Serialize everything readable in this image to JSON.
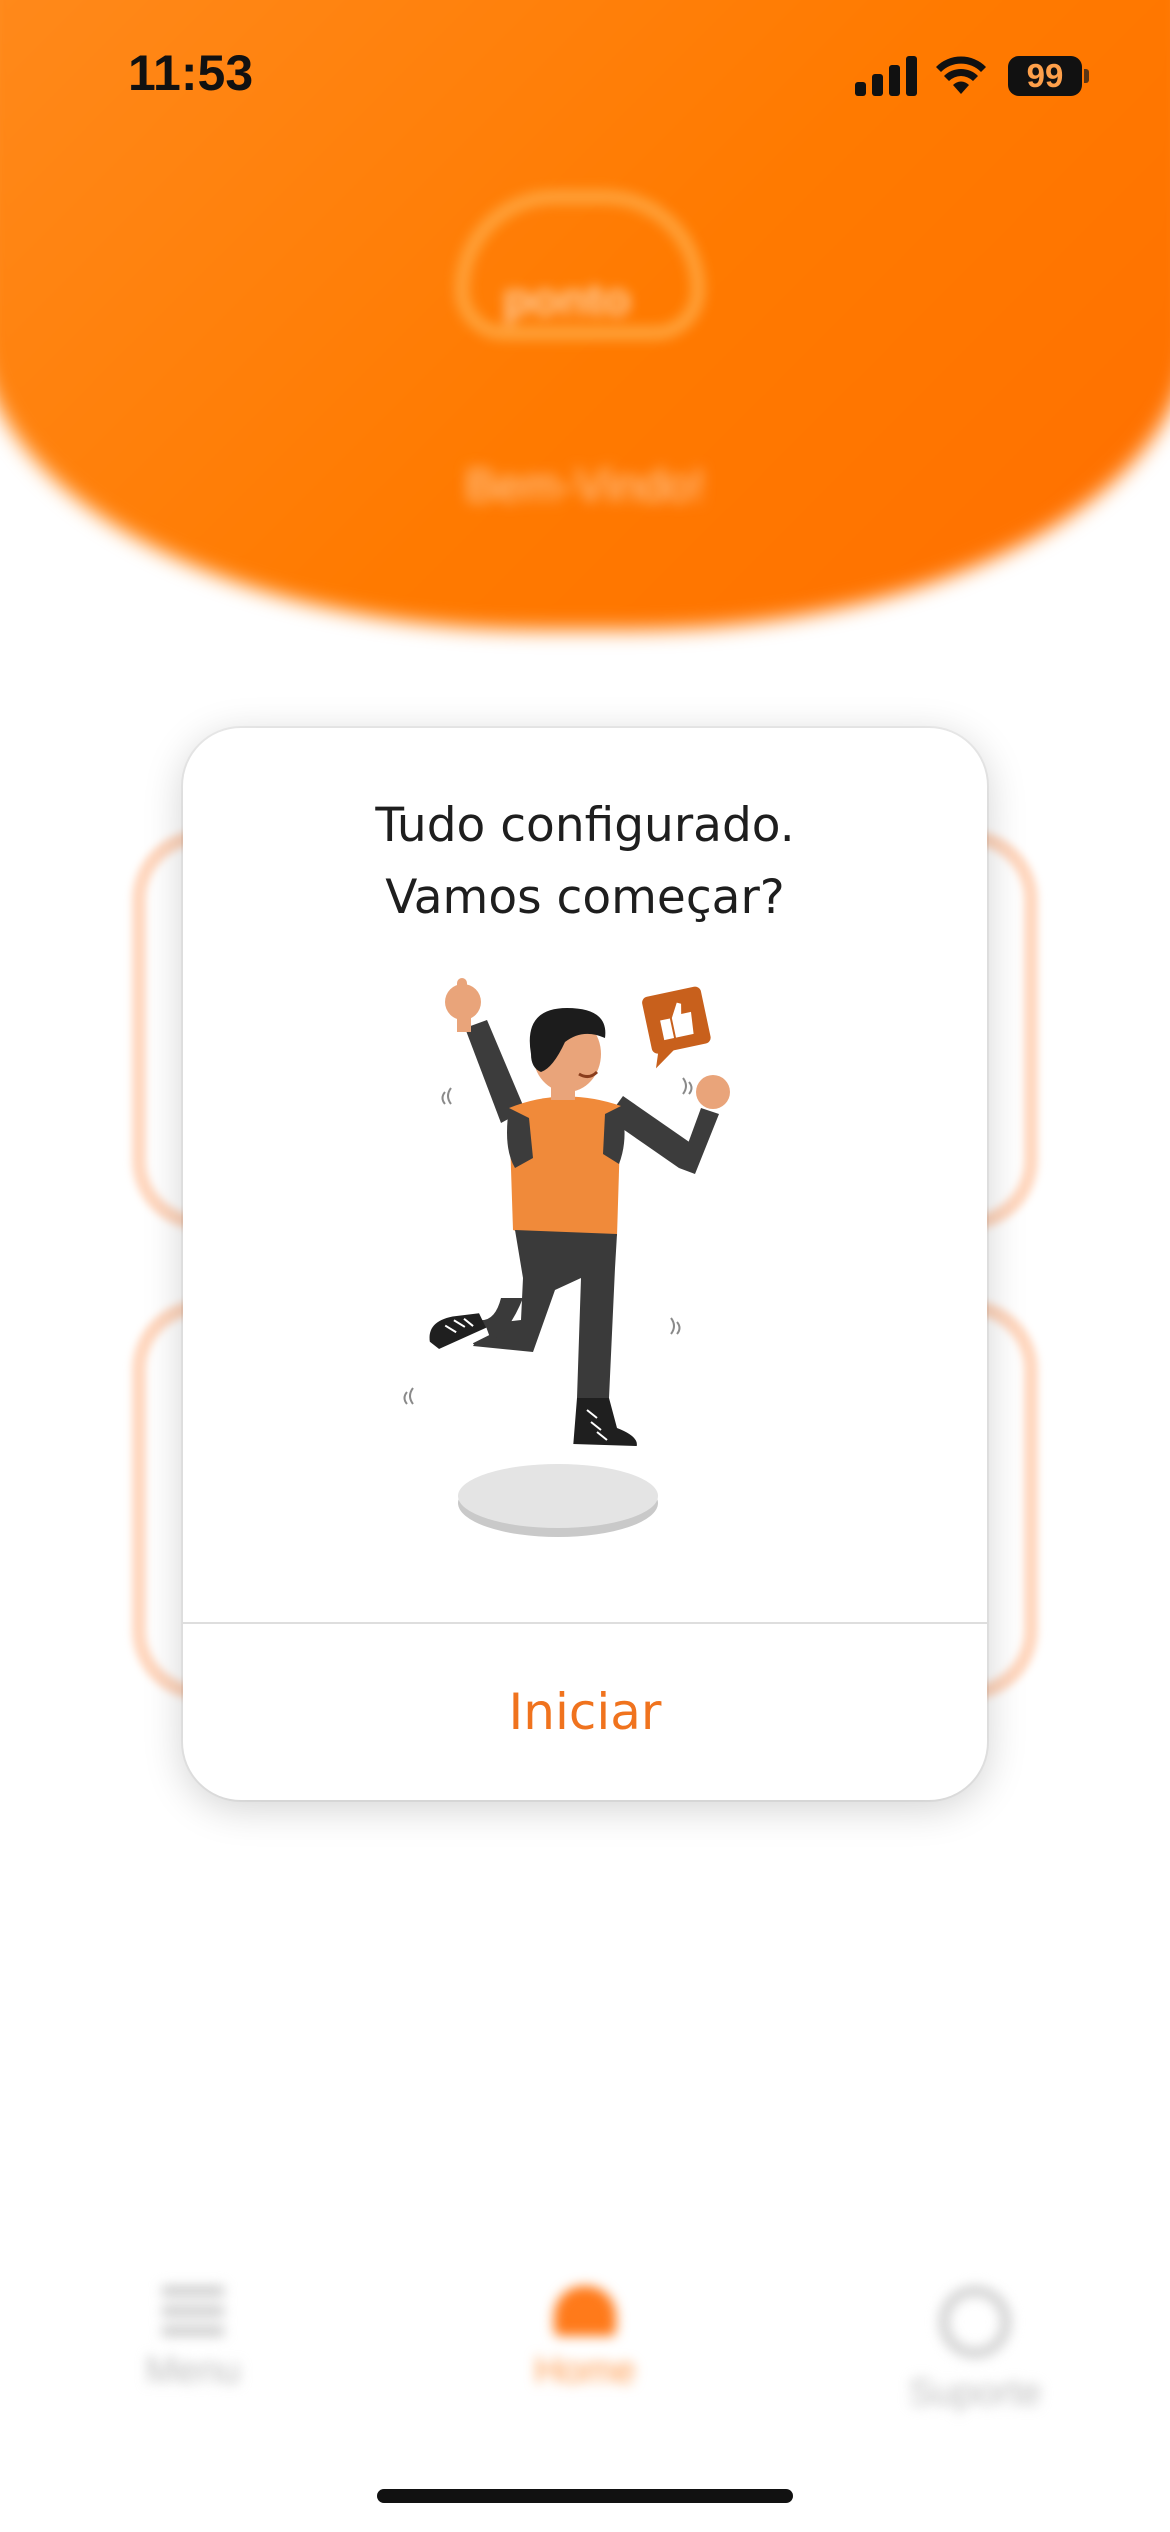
{
  "status_bar": {
    "time": "11:53",
    "battery": "99",
    "icons": [
      "signal-icon",
      "wifi-icon",
      "battery-icon"
    ]
  },
  "background": {
    "logo_text": "ponto",
    "welcome_text": "Bem-Vindo!",
    "tab_bar": [
      {
        "label": "Menu",
        "icon": "menu-icon"
      },
      {
        "label": "Home",
        "icon": "home-icon"
      },
      {
        "label": "Suporte",
        "icon": "help-icon"
      }
    ]
  },
  "dialog": {
    "title_line1": "Tudo configurado.",
    "title_line2": "Vamos começar?",
    "illustration": "celebrating-person-illustration",
    "button_label": "Iniciar"
  },
  "colors": {
    "accent": "#f0731e",
    "header_orange": "#ff7a00"
  }
}
